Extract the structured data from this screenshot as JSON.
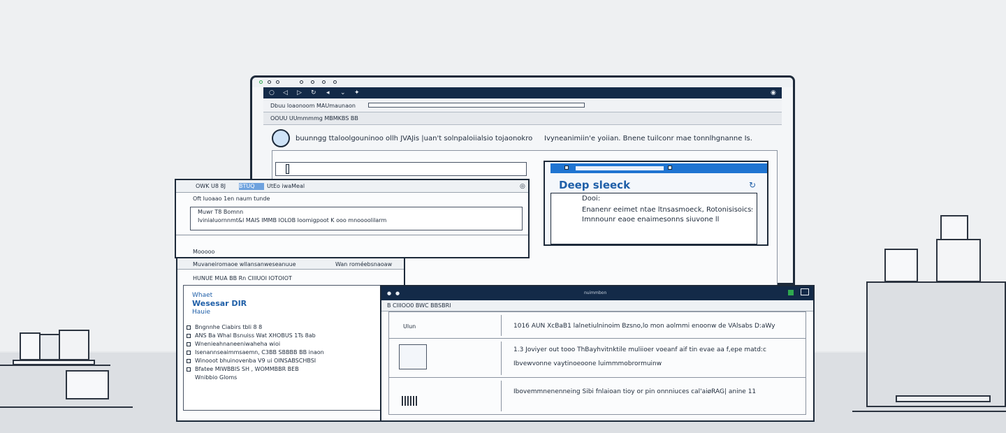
{
  "main_window": {
    "title": "",
    "url_bar_text": "Dbuu loaonoom MAUmaunaon",
    "section_header": "OOUU UUmmmmg MBMKBS BB",
    "headline_left": "buunngg ttaloolgouninoo ollh JVAJis |uan't solnpaloiialsio tojaonokrolk",
    "headline_right": "Ivyneanimiin'e yoiian. Bnene tuilconr mae tonnlhgnanne Is."
  },
  "deep_window": {
    "brand": "Deep sleeck",
    "sub_label": "Dooi:",
    "line1": "Enanenr eeimet ntae ltnsasmoeck, Rotonisisoicssie",
    "line2": "Imnnounr eaoe enaimesonns siuvone ll"
  },
  "left_window": {
    "title": "OWK U8 8J",
    "title_highlight": "BTUQ",
    "title_rest": "UtEo iwaMeal",
    "sub_header": "Oft luoaao 1en naum tunde",
    "field_label": "Muwr T8 Bomnn",
    "field_text": "Ivinialuornnmt&l MAIS IMMB IOLOB loomigpoot K ooo mnoooolilarm",
    "section_label": "Mooooo"
  },
  "mid_window": {
    "toolbar_left": "Muvaneiromaoe wllansanweseanuue",
    "toolbar_right": "Wan roméebsnaoaw",
    "sub_header": "HUNUE MUA BB Rn CIIIUOI IOTOIOT",
    "brand_line1": "Whaet",
    "brand_line2": "Wesesar DIR",
    "brand_line3": "Hauie",
    "list_items": [
      "Bngnnhe Ciabirs tbli 8 8",
      "ANS Ba Whal Bsnuiss Wat XHOBUS 1Ts 8ab",
      "Wnenieahnaneeniwaheha wioi",
      "Isenannseaimmsaemn, C3BB SBBBB BB inaon",
      "Winooot bhuinovenba V9 ui OINSABSCHBSI",
      "Bfatee MIWBBIS SH , WOMMBBR BEB",
      "Wnibbio Gloms"
    ]
  },
  "bottom_window": {
    "title": "nuimmbon",
    "sub_header": "B CIIIOO0 BWC BBSBRI",
    "rows": [
      {
        "left": "Ulun",
        "text": "1016 AUN XcBaB1 lalnetiulninoim Bzsno,lo mon aolmmi enoonw de VAlsabs D:aWy"
      },
      {
        "left": "",
        "text": "1.3 Joviyer out tooo ThBayhvitnktile muliioer voeanf aif tin evae aa f,epe matd:c",
        "text2": "Ibvewvonne vaytinoeoone luimmmobrormuinw"
      },
      {
        "left": "",
        "text": "Ibovemmnenenneing Sibi fnlaioan tioy or pin onnniuces cal'aiøRAG| anine 11"
      }
    ]
  },
  "colors": {
    "titlebar": "#132a48",
    "accent": "#1f74d1",
    "frame": "#1d2a3a"
  }
}
